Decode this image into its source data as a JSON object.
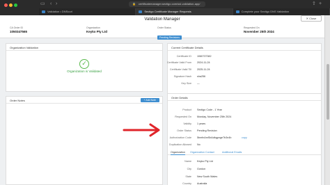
{
  "browser": {
    "url": "certificatemanager.sectigo.com/ssl-validation-app/",
    "tabs": [
      {
        "label": "Validation • DNScurl"
      },
      {
        "label": "Sectigo Certificate Manager Requests"
      },
      {
        "label": "Complete your Sectigo DNS Validation"
      }
    ]
  },
  "header": {
    "title": "Validation Manager",
    "close_label": "Close",
    "ca_order_id_label": "CA Order ID",
    "ca_order_id": "1050347565",
    "organization_label": "Organization",
    "organization": "Keyko Pty Ltd",
    "order_status_label": "Order Status",
    "order_status": "Pending Revisions",
    "requested_on_label": "Requested On",
    "requested_on": "November 25th 2024"
  },
  "org_validation": {
    "title": "Organization Validation",
    "status_text": "Organization is Validated"
  },
  "order_notes": {
    "title": "Order Notes",
    "add_label": "+ Add Note"
  },
  "current_cert": {
    "title": "Current Certificate Details",
    "rows": [
      {
        "k": "Certificate ID",
        "v": "1060737382"
      },
      {
        "k": "Certificate Valid From",
        "v": "2024-11-24"
      },
      {
        "k": "Certificate Valid Till",
        "v": "2025-11-24"
      },
      {
        "k": "Signature Hash",
        "v": "sha256"
      },
      {
        "k": "Key Size",
        "v": "—"
      }
    ]
  },
  "order_details": {
    "title": "Order Details",
    "rows": [
      {
        "k": "Product",
        "v": "Sectigo Code - 1 Year"
      },
      {
        "k": "Requested On",
        "v": "Monday, November 25th 2024"
      },
      {
        "k": "Validity",
        "v": "1 years"
      },
      {
        "k": "Order Status",
        "v": "Pending Revision"
      },
      {
        "k": "Authorization Code",
        "v": "5bmfnAmSbAdbgpnge7b3n4b"
      },
      {
        "k": "Duplication Allowed",
        "v": "No"
      }
    ],
    "copy_label": "copy",
    "tabs": [
      "Organization",
      "Organization Contact",
      "Additional Emails"
    ],
    "org_rows": [
      {
        "k": "Name",
        "v": "Keyko Pty Ltd"
      },
      {
        "k": "City",
        "v": "Gordon"
      },
      {
        "k": "State",
        "v": "New South Wales"
      },
      {
        "k": "Country",
        "v": "Australia"
      }
    ]
  },
  "colors": {
    "accent": "#3e8ed0",
    "success": "#59b84a",
    "arrow": "#e0242a"
  }
}
